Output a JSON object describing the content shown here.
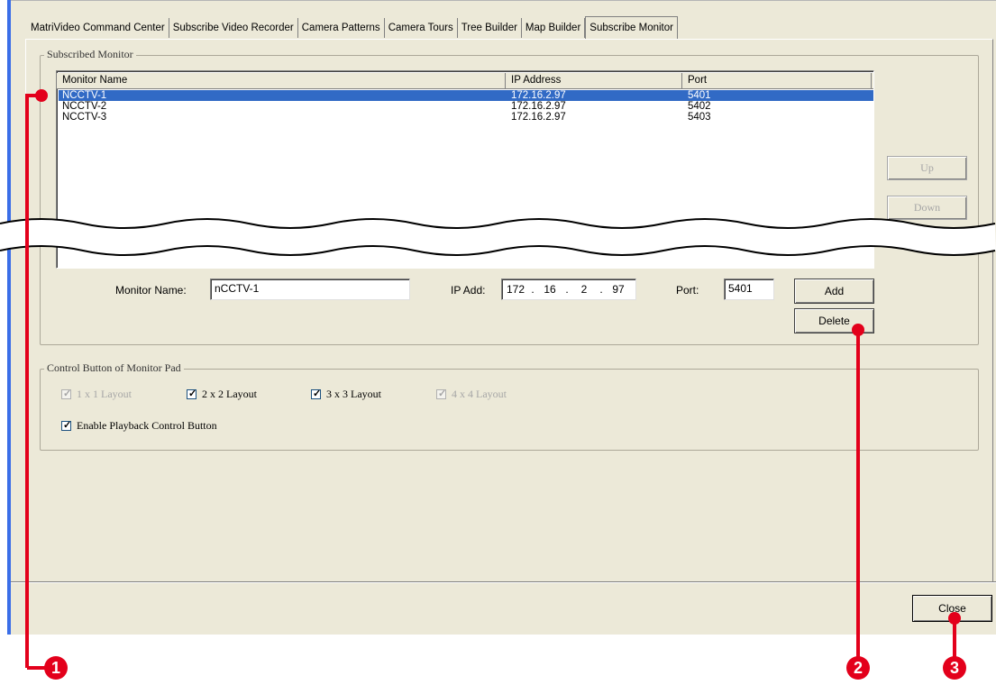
{
  "tabs": [
    {
      "label": "MatriVideo Command Center",
      "active": false
    },
    {
      "label": "Subscribe Video Recorder",
      "active": false
    },
    {
      "label": "Camera Patterns",
      "active": false
    },
    {
      "label": "Camera Tours",
      "active": false
    },
    {
      "label": "Tree Builder",
      "active": false
    },
    {
      "label": "Map Builder",
      "active": false
    },
    {
      "label": "Subscribe Monitor",
      "active": true
    }
  ],
  "subscribed_monitor": {
    "group_title": "Subscribed Monitor",
    "columns": [
      "Monitor Name",
      "IP Address",
      "Port"
    ],
    "rows": [
      {
        "name": "NCCTV-1",
        "ip": "172.16.2.97",
        "port": "5401",
        "selected": true
      },
      {
        "name": "NCCTV-2",
        "ip": "172.16.2.97",
        "port": "5402",
        "selected": false
      },
      {
        "name": "NCCTV-3",
        "ip": "172.16.2.97",
        "port": "5403",
        "selected": false
      }
    ],
    "up_label": "Up",
    "down_label": "Down"
  },
  "form": {
    "monitor_name_label": "Monitor Name:",
    "monitor_name_value": "nCCTV-1",
    "ip_label": "IP Add:",
    "ip_octets": [
      "172",
      "16",
      "2",
      "97"
    ],
    "ip_dot": ".",
    "port_label": "Port:",
    "port_value": "5401",
    "add_label": "Add",
    "delete_label": "Delete"
  },
  "control_buttons": {
    "group_title": "Control Button of Monitor Pad",
    "layouts": [
      {
        "label": "1 x 1 Layout",
        "checked": true,
        "enabled": false
      },
      {
        "label": "2 x 2 Layout",
        "checked": true,
        "enabled": true
      },
      {
        "label": "3 x 3 Layout",
        "checked": true,
        "enabled": true
      },
      {
        "label": "4 x 4 Layout",
        "checked": true,
        "enabled": false
      }
    ],
    "playback_label": "Enable Playback Control Button",
    "playback_checked": true
  },
  "close_label": "Close",
  "callouts": [
    "1",
    "2",
    "3"
  ],
  "colors": {
    "callout": "#e3001b",
    "selection": "#316ac5",
    "window": "#ece9d8"
  }
}
